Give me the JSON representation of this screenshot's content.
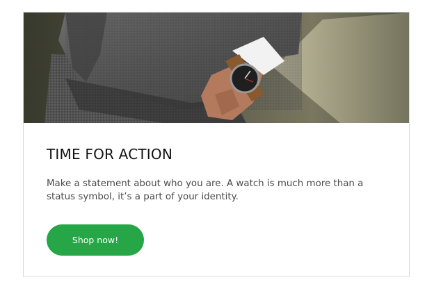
{
  "card": {
    "hero_image": {
      "icon": "man-in-suit-wearing-wristwatch-photo"
    },
    "title": "TIME FOR ACTION",
    "description": "Make a statement about who you are. A watch is much more than a status symbol, it’s a part of your identity.",
    "cta_label": "Shop now!"
  },
  "colors": {
    "accent": "#27a647",
    "title_text": "#111111",
    "body_text": "#4a4a4a",
    "card_border": "#d9d9d9"
  }
}
